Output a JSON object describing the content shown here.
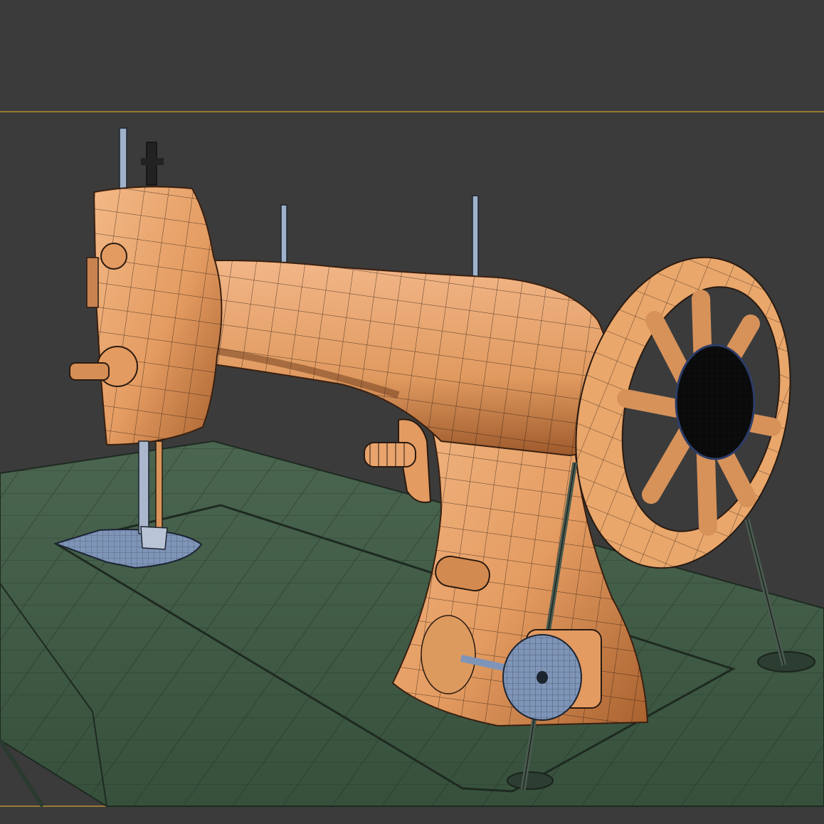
{
  "viewport": {
    "background_color": "#3b3b3b",
    "safe_frame_color": "#c89a3a",
    "body_color": "#e8a46c",
    "body_shadow_color": "#b0663a",
    "table_color": "#3f5a45",
    "metal_color": "#7f95b8",
    "wire_color": "#1a1a1a"
  }
}
